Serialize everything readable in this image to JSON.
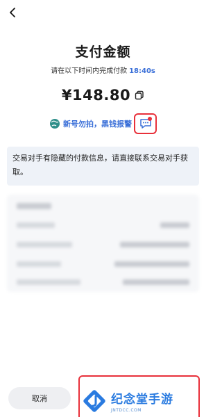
{
  "header": {
    "title": "支付金额"
  },
  "deadline": {
    "prefix": "请在以下时间内完成付款",
    "time": "18:40s"
  },
  "payment": {
    "amount": "¥148.80"
  },
  "warning": {
    "text": "新号勿拍，黑钱报警"
  },
  "notice": {
    "text": "交易对手有隐藏的付款信息，请直接联系交易对手获取。"
  },
  "actions": {
    "cancel_label": "取消"
  },
  "watermark": {
    "title": "纪念堂手游",
    "subtitle": "JNTDCC.COM"
  },
  "icons": {
    "back": "chevron-left-icon",
    "copy": "copy-icon",
    "globe": "globe-icon",
    "chat": "chat-bubble-icon"
  },
  "colors": {
    "accent": "#3a6fd8",
    "alert": "#e8303a"
  }
}
